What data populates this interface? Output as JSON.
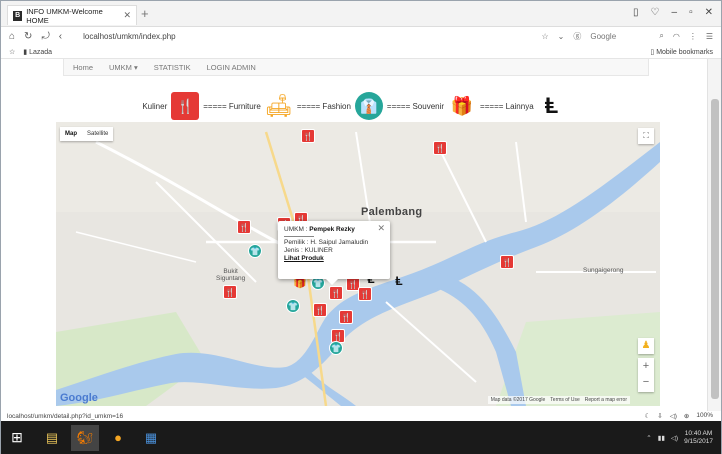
{
  "browser": {
    "tab_title": "INFO UMKM-Welcome HOME",
    "favicon_letter": "B",
    "url": "localhost/umkm/index.php",
    "search_engine": "Google",
    "bookmark": "Lazada",
    "mobile_bookmarks": "Mobile bookmarks",
    "status_url": "localhost/umkm/detail.php?id_umkm=16",
    "zoom_level": "100%"
  },
  "site_nav": {
    "items": [
      "Home",
      "UMKM ▾",
      "STATISTIK",
      "LOGIN ADMIN"
    ]
  },
  "legend": {
    "kuliner": "Kuliner",
    "sep1": "===== Furniture",
    "sep2": "===== Fashion",
    "sep3": "===== Souvenir",
    "sep4": "===== Lainnya"
  },
  "map": {
    "type_map": "Map",
    "type_satellite": "Satellite",
    "city_label": "Palembang",
    "place_bukit": "Bukit\nSiguntang",
    "place_sungai": "Sungaigerong",
    "google_logo": "Google",
    "footer": [
      "Map data ©2017 Google",
      "Terms of Use",
      "Report a map error"
    ]
  },
  "infowindow": {
    "title_prefix": "UMKM :",
    "title_name": "Pempek Rezky",
    "owner": "Pemilik : H. Saipul Jamaludin",
    "type": "Jenis : KULINER",
    "link": "Lihat Produk"
  },
  "taskbar": {
    "time": "10:40 AM",
    "date": "9/15/2017"
  },
  "colors": {
    "kuliner": "#e53935",
    "fashion": "#26a69a",
    "furniture": "#f5a623",
    "souvenir": "#8e44ad"
  }
}
